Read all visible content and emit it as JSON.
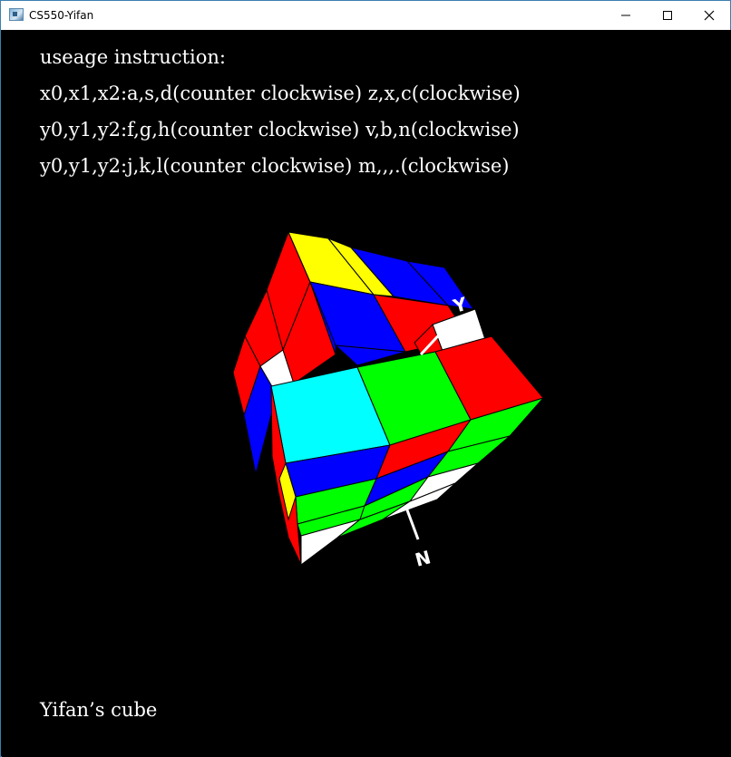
{
  "window": {
    "title": "CS550-Yifan",
    "app_icon": "window-app-icon",
    "controls": {
      "minimize": "minimize-icon",
      "maximize": "maximize-icon",
      "close": "close-icon"
    }
  },
  "instructions": {
    "heading": "useage instruction:",
    "line1": "x0,x1,x2:a,s,d(counter clockwise) z,x,c(clockwise)",
    "line2": "y0,y1,y2:f,g,h(counter clockwise) v,b,n(clockwise)",
    "line3": "y0,y1,y2:j,k,l(counter clockwise) m,,,.(clockwise)"
  },
  "axes": {
    "y_label": "Y",
    "z_label": "N"
  },
  "footer": {
    "label": "Yifan’s cube"
  },
  "colors": {
    "blue": "#0000ff",
    "yellow": "#ffff00",
    "red": "#ff0000",
    "white": "#ffffff",
    "cyan": "#00ffff",
    "green": "#00ff00",
    "background": "#000000"
  }
}
